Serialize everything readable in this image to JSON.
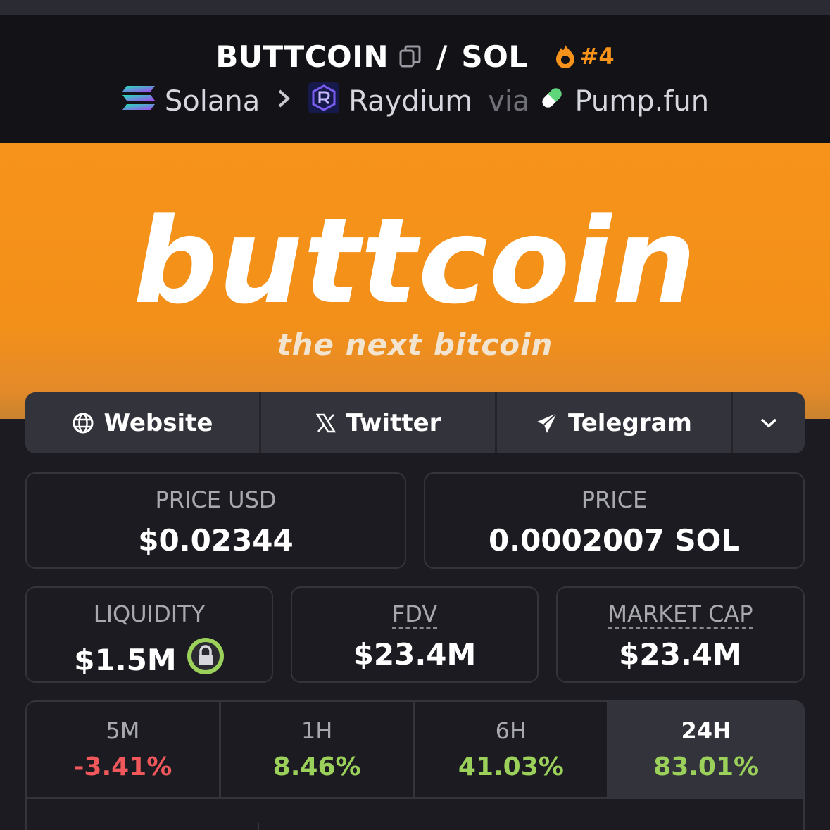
{
  "header": {
    "token_symbol": "BUTTCOIN",
    "separator": "/",
    "quote_symbol": "SOL",
    "trending_rank": "#4",
    "chain": "Solana",
    "dex": "Raydium",
    "via": "via",
    "launchpad": "Pump.fun"
  },
  "banner": {
    "wordmark": "buttcoin",
    "tagline": "the next bitcoin"
  },
  "links": {
    "website": "Website",
    "twitter": "Twitter",
    "telegram": "Telegram"
  },
  "stats": {
    "price_usd_label": "PRICE USD",
    "price_usd": "$0.02344",
    "price_label": "PRICE",
    "price_sol": "0.0002007 SOL",
    "liquidity_label": "LIQUIDITY",
    "liquidity": "$1.5M",
    "fdv_label": "FDV",
    "fdv": "$23.4M",
    "mcap_label": "MARKET CAP",
    "mcap": "$23.4M"
  },
  "changes": [
    {
      "period": "5M",
      "change": "-3.41%"
    },
    {
      "period": "1H",
      "change": "8.46%"
    },
    {
      "period": "6H",
      "change": "41.03%"
    },
    {
      "period": "24H",
      "change": "83.01%"
    }
  ],
  "colors": {
    "accent_orange": "#f7931a",
    "positive": "#9bd15a",
    "negative": "#f0585b",
    "lock_green": "#9bd15a"
  }
}
